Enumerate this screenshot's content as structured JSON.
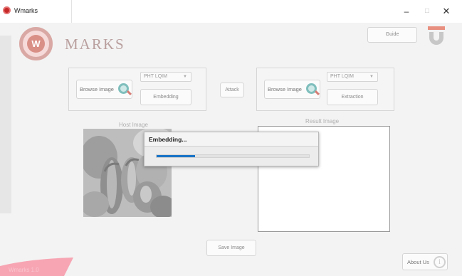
{
  "window": {
    "title": "Wmarks",
    "min_glyph": "–",
    "max_glyph": "□",
    "close_glyph": "✕"
  },
  "brand": {
    "logo_letter": "W",
    "name": "MARKS"
  },
  "toolbar": {
    "guide_label": "Guide"
  },
  "embed_panel": {
    "browse_label": "Browse Image",
    "method_selected": "PHT LQIM",
    "embed_label": "Embedding"
  },
  "attack_label": "Attack",
  "extract_panel": {
    "browse_label": "Browse Image",
    "method_selected": "PHT LQIM",
    "extract_label": "Extraction"
  },
  "host_caption": "Host Image",
  "result_caption": "Result Image",
  "save_label": "Save Image",
  "about_label": "About Us",
  "about_icon_glyph": "i",
  "version_text": "Wmarks 1.0",
  "progress_dialog": {
    "title": "Embedding...",
    "progress_fraction": 0.25
  },
  "colors": {
    "brand_pink": "#d9a8a4",
    "progress_blue": "#1a73c6",
    "badge_pink": "#f7a5b3"
  },
  "icons": [
    "search-icon",
    "info-icon",
    "u-logo",
    "app-logo"
  ]
}
